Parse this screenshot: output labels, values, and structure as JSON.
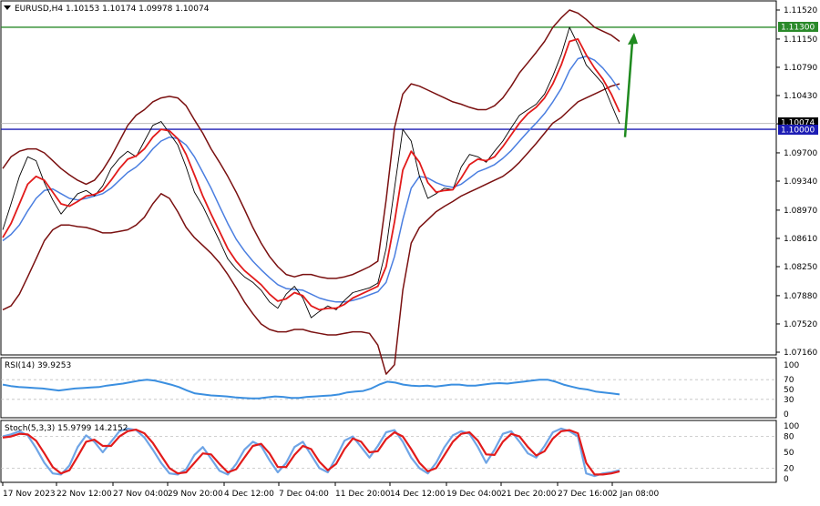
{
  "header": {
    "symbol": "EURUSD,H4",
    "ohlc": "1.10153 1.10174 1.09978 1.10074"
  },
  "colors": {
    "upper_level": "#2a8a2a",
    "lower_level": "#1c1cb4",
    "arrow": "#1f8a1f",
    "bands": "#7a1010",
    "ma_fast": "#e21b1b",
    "ma_slow": "#4a7ee0",
    "price": "#000000",
    "rsi_line": "#3b8fe0",
    "stoch_main": "#6fa5e6",
    "stoch_signal": "#e21b1b",
    "tag_price": "#000000",
    "tag_green": "#2a8a2a",
    "tag_blue": "#1c1cb4"
  },
  "panels": {
    "rsi_label": "RSI(14) 39.9253",
    "stoch_label": "Stoch(5,3,3) 15.9799 14.2152"
  },
  "chart_data": [
    {
      "type": "line",
      "title": "EURUSD,H4",
      "y_axis_ticks": [
        "1.11520",
        "1.11150",
        "1.10790",
        "1.10430",
        "1.10070",
        "1.09700",
        "1.09340",
        "1.08970",
        "1.08610",
        "1.08250",
        "1.07880",
        "1.07520",
        "1.07160"
      ],
      "x_axis_ticks": [
        "17 Nov 2023",
        "22 Nov 12:00",
        "27 Nov 04:00",
        "29 Nov 20:00",
        "4 Dec 12:00",
        "7 Dec 04:00",
        "11 Dec 20:00",
        "14 Dec 12:00",
        "19 Dec 04:00",
        "21 Dec 20:00",
        "27 Dec 16:00",
        "2 Jan 08:00"
      ],
      "levels": [
        {
          "name": "1.11300",
          "value": 1.113
        },
        {
          "name": "1.10000",
          "value": 1.1
        }
      ],
      "current_price": {
        "label": "1.10074",
        "value": 1.10074
      },
      "arrow": {
        "direction": "up",
        "from": 1.099,
        "to": 1.1123
      },
      "grid": false,
      "series": [
        {
          "name": "Close",
          "values": [
            1.0872,
            1.0905,
            1.094,
            1.0965,
            1.096,
            1.0932,
            1.091,
            1.0892,
            1.0905,
            1.0918,
            1.0922,
            1.0915,
            1.0928,
            1.095,
            1.0963,
            1.0972,
            1.0965,
            1.0985,
            1.1005,
            1.101,
            1.0995,
            1.098,
            1.0952,
            1.092,
            1.0902,
            1.088,
            1.0858,
            1.0835,
            1.0822,
            1.0812,
            1.0805,
            1.0795,
            1.078,
            1.0772,
            1.079,
            1.08,
            1.0785,
            1.076,
            1.0768,
            1.0775,
            1.077,
            1.0782,
            1.0792,
            1.0795,
            1.0798,
            1.0804,
            1.0848,
            1.0925,
            1.1,
            1.0985,
            1.094,
            1.0912,
            1.0918,
            1.0925,
            1.0923,
            1.0952,
            1.0968,
            1.0965,
            1.0958,
            1.0972,
            1.0985,
            1.1002,
            1.1018,
            1.1025,
            1.1032,
            1.1045,
            1.1068,
            1.1095,
            1.113,
            1.1108,
            1.1082,
            1.107,
            1.1058,
            1.1032,
            1.1007
          ]
        },
        {
          "name": "MA fast",
          "values": [
            1.0862,
            1.088,
            1.0905,
            1.093,
            1.094,
            1.0935,
            1.092,
            1.0905,
            1.0902,
            1.0908,
            1.0915,
            1.0917,
            1.0922,
            1.0935,
            1.095,
            1.0962,
            1.0966,
            1.0975,
            1.099,
            1.1,
            1.0998,
            1.0988,
            1.0968,
            1.0942,
            1.0915,
            1.0892,
            1.087,
            1.0848,
            1.0832,
            1.082,
            1.0811,
            1.0802,
            1.079,
            1.0781,
            1.0784,
            1.0792,
            1.0788,
            1.0775,
            1.077,
            1.0772,
            1.0772,
            1.0777,
            1.0785,
            1.079,
            1.0795,
            1.08,
            1.0825,
            1.0882,
            1.0948,
            1.0972,
            1.0958,
            1.0932,
            1.092,
            1.0922,
            1.0923,
            1.0938,
            1.0955,
            1.0962,
            1.096,
            1.0965,
            1.0978,
            1.0993,
            1.1008,
            1.102,
            1.1028,
            1.104,
            1.1058,
            1.1082,
            1.1112,
            1.1115,
            1.1095,
            1.1078,
            1.1064,
            1.1045,
            1.1022
          ]
        },
        {
          "name": "MA slow",
          "values": [
            1.0858,
            1.0866,
            1.0878,
            1.0896,
            1.0912,
            1.0922,
            1.0924,
            1.0918,
            1.0912,
            1.091,
            1.0912,
            1.0915,
            1.0918,
            1.0925,
            1.0935,
            1.0945,
            1.0952,
            1.0962,
            1.0975,
            1.0985,
            1.099,
            1.0988,
            1.098,
            1.0965,
            1.0945,
            1.0925,
            1.0902,
            1.088,
            1.086,
            1.0845,
            1.0832,
            1.0821,
            1.0811,
            1.0802,
            1.0797,
            1.0796,
            1.0795,
            1.079,
            1.0785,
            1.0782,
            1.078,
            1.078,
            1.0782,
            1.0785,
            1.0789,
            1.0793,
            1.0805,
            1.0838,
            1.0885,
            1.0925,
            1.094,
            1.0938,
            1.0932,
            1.0928,
            1.0926,
            1.093,
            1.0938,
            1.0946,
            1.095,
            1.0955,
            1.0963,
            1.0973,
            1.0985,
            1.0997,
            1.1008,
            1.102,
            1.1035,
            1.1052,
            1.1075,
            1.109,
            1.1093,
            1.1088,
            1.1078,
            1.1065,
            1.105
          ]
        },
        {
          "name": "Band upper",
          "values": [
            1.095,
            1.0965,
            1.0972,
            1.0975,
            1.0975,
            1.097,
            1.096,
            1.095,
            1.0942,
            1.0935,
            1.093,
            1.0935,
            1.0948,
            1.0965,
            1.0985,
            1.1005,
            1.1018,
            1.1025,
            1.1035,
            1.104,
            1.1042,
            1.104,
            1.103,
            1.1012,
            1.0995,
            1.0975,
            1.0958,
            1.094,
            1.092,
            1.0898,
            1.0875,
            1.0855,
            1.0838,
            1.0825,
            1.0815,
            1.0812,
            1.0815,
            1.0815,
            1.0812,
            1.081,
            1.081,
            1.0812,
            1.0815,
            1.082,
            1.0825,
            1.0832,
            1.091,
            1.1002,
            1.1045,
            1.1058,
            1.1055,
            1.105,
            1.1045,
            1.104,
            1.1035,
            1.1032,
            1.1028,
            1.1025,
            1.1025,
            1.103,
            1.104,
            1.1055,
            1.1072,
            1.1085,
            1.1098,
            1.1112,
            1.113,
            1.1142,
            1.1152,
            1.1148,
            1.114,
            1.113,
            1.1125,
            1.112,
            1.1112
          ]
        },
        {
          "name": "Band lower",
          "values": [
            1.077,
            1.0775,
            1.079,
            1.0812,
            1.0835,
            1.0858,
            1.0872,
            1.0878,
            1.0878,
            1.0876,
            1.0875,
            1.0872,
            1.0868,
            1.0868,
            1.087,
            1.0872,
            1.0878,
            1.0888,
            1.0905,
            1.0918,
            1.0912,
            1.0895,
            1.0875,
            1.0862,
            1.0852,
            1.0842,
            1.083,
            1.0815,
            1.0798,
            1.078,
            1.0765,
            1.0752,
            1.0745,
            1.0742,
            1.0742,
            1.0745,
            1.0745,
            1.0742,
            1.074,
            1.0738,
            1.0738,
            1.074,
            1.0742,
            1.0742,
            1.074,
            1.0725,
            1.0688,
            1.07,
            1.0795,
            1.0855,
            1.0875,
            1.0885,
            1.0895,
            1.0902,
            1.0908,
            1.0915,
            1.092,
            1.0925,
            1.093,
            1.0935,
            1.094,
            1.0948,
            1.0958,
            1.097,
            1.0982,
            1.0995,
            1.1008,
            1.1015,
            1.1025,
            1.1035,
            1.104,
            1.1045,
            1.105,
            1.1055,
            1.1058
          ]
        }
      ]
    },
    {
      "type": "line",
      "title": "RSI(14) 39.9253",
      "ylim": [
        0,
        100
      ],
      "y_axis_ticks": [
        "100",
        "70",
        "50",
        "30",
        "0"
      ],
      "series": [
        {
          "name": "RSI(14)",
          "values": [
            60,
            57,
            55,
            54,
            53,
            52,
            50,
            48,
            50,
            52,
            53,
            54,
            55,
            58,
            60,
            62,
            65,
            68,
            70,
            68,
            64,
            60,
            55,
            48,
            42,
            40,
            38,
            37,
            36,
            34,
            33,
            32,
            32,
            34,
            36,
            35,
            33,
            33,
            35,
            36,
            37,
            38,
            40,
            44,
            46,
            47,
            52,
            60,
            66,
            64,
            60,
            58,
            57,
            58,
            56,
            58,
            60,
            60,
            58,
            58,
            60,
            62,
            63,
            62,
            64,
            66,
            68,
            70,
            70,
            66,
            60,
            56,
            52,
            50,
            46,
            44,
            42,
            40
          ]
        }
      ]
    },
    {
      "type": "line",
      "title": "Stoch(5,3,3) 15.9799 14.2152",
      "ylim": [
        0,
        100
      ],
      "y_axis_ticks": [
        "100",
        "80",
        "50",
        "20",
        "0"
      ],
      "series": [
        {
          "name": "Main",
          "values": [
            80,
            84,
            90,
            82,
            58,
            30,
            10,
            8,
            25,
            60,
            82,
            70,
            50,
            70,
            90,
            95,
            92,
            78,
            55,
            30,
            10,
            8,
            18,
            45,
            60,
            38,
            15,
            8,
            28,
            55,
            70,
            62,
            35,
            12,
            30,
            60,
            70,
            45,
            20,
            12,
            40,
            72,
            80,
            60,
            40,
            62,
            88,
            92,
            70,
            40,
            20,
            10,
            30,
            60,
            82,
            90,
            85,
            60,
            30,
            55,
            85,
            90,
            70,
            48,
            40,
            62,
            88,
            95,
            90,
            80,
            10,
            5,
            10,
            12,
            16
          ]
        },
        {
          "name": "Signal",
          "values": [
            78,
            80,
            85,
            84,
            72,
            48,
            22,
            10,
            16,
            42,
            70,
            74,
            62,
            62,
            80,
            90,
            93,
            86,
            68,
            44,
            20,
            10,
            12,
            30,
            48,
            46,
            28,
            12,
            18,
            40,
            62,
            66,
            48,
            22,
            22,
            45,
            62,
            56,
            32,
            16,
            28,
            56,
            76,
            70,
            50,
            52,
            75,
            88,
            80,
            56,
            30,
            14,
            20,
            45,
            70,
            85,
            88,
            72,
            46,
            45,
            70,
            85,
            80,
            60,
            44,
            52,
            76,
            90,
            92,
            86,
            30,
            8,
            8,
            10,
            14
          ]
        }
      ]
    }
  ],
  "price_axis": {
    "tag_price": "1.10074",
    "tag_green": "1.11300",
    "tag_blue": "1.10000"
  }
}
